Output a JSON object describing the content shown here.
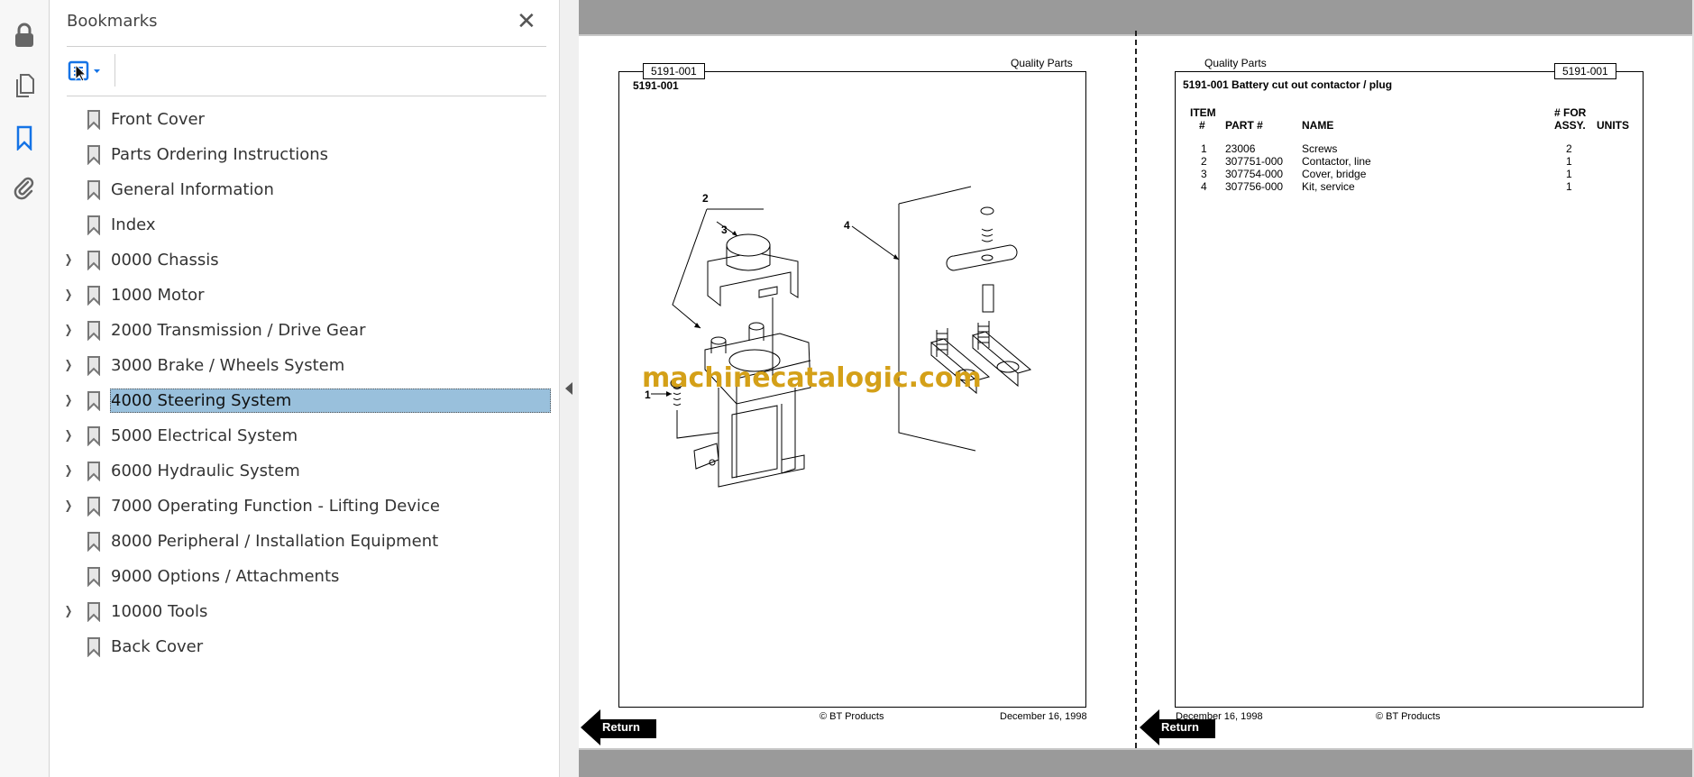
{
  "rail": {
    "icons": [
      "lock-icon",
      "pages-icon",
      "bookmark-icon",
      "attachment-icon"
    ]
  },
  "panel": {
    "title": "Bookmarks",
    "items": [
      {
        "label": "Front Cover",
        "expandable": false
      },
      {
        "label": "Parts Ordering Instructions",
        "expandable": false
      },
      {
        "label": "General Information",
        "expandable": false
      },
      {
        "label": "Index",
        "expandable": false
      },
      {
        "label": "0000 Chassis",
        "expandable": true
      },
      {
        "label": "1000 Motor",
        "expandable": true
      },
      {
        "label": "2000 Transmission / Drive Gear",
        "expandable": true
      },
      {
        "label": "3000 Brake / Wheels System",
        "expandable": true
      },
      {
        "label": "4000 Steering System",
        "expandable": true,
        "selected": true
      },
      {
        "label": "5000 Electrical System",
        "expandable": true
      },
      {
        "label": "6000 Hydraulic System",
        "expandable": true
      },
      {
        "label": "7000 Operating Function - Lifting Device",
        "expandable": true
      },
      {
        "label": "8000 Peripheral / Installation Equipment",
        "expandable": false
      },
      {
        "label": "9000 Options / Attachments",
        "expandable": false
      },
      {
        "label": "10000 Tools",
        "expandable": true
      },
      {
        "label": "Back Cover",
        "expandable": false
      }
    ]
  },
  "left_page": {
    "tag": "5191-001",
    "header_right": "Quality Parts",
    "code": "5191-001",
    "callouts": [
      "1",
      "2",
      "3",
      "4"
    ],
    "footer_copyright": "© BT Products",
    "footer_date": "December 16, 1998",
    "return_label": "Return"
  },
  "right_page": {
    "header_left": "Quality Parts",
    "tag": "5191-001",
    "title": "5191-001 Battery cut out contactor / plug",
    "columns": {
      "item_top": "ITEM",
      "item": "#",
      "part": "PART #",
      "name": "NAME",
      "for_top": "# FOR",
      "assy": "ASSY.",
      "units": "UNITS"
    },
    "rows": [
      {
        "item": "1",
        "part": "23006",
        "name": "Screws",
        "qty": "2"
      },
      {
        "item": "2",
        "part": "307751-000",
        "name": "Contactor, line",
        "qty": "1"
      },
      {
        "item": "3",
        "part": "307754-000",
        "name": "Cover, bridge",
        "qty": "1"
      },
      {
        "item": "4",
        "part": "307756-000",
        "name": "Kit, service",
        "qty": "1"
      }
    ],
    "footer_date": "December 16, 1998",
    "footer_copyright": "© BT Products",
    "return_label": "Return"
  },
  "watermark": "machinecatalogic.com",
  "colors": {
    "accent": "#1473e6",
    "selection": "#99c0dc",
    "watermark": "#d4a018",
    "gray_bar": "#9a9a9a"
  }
}
